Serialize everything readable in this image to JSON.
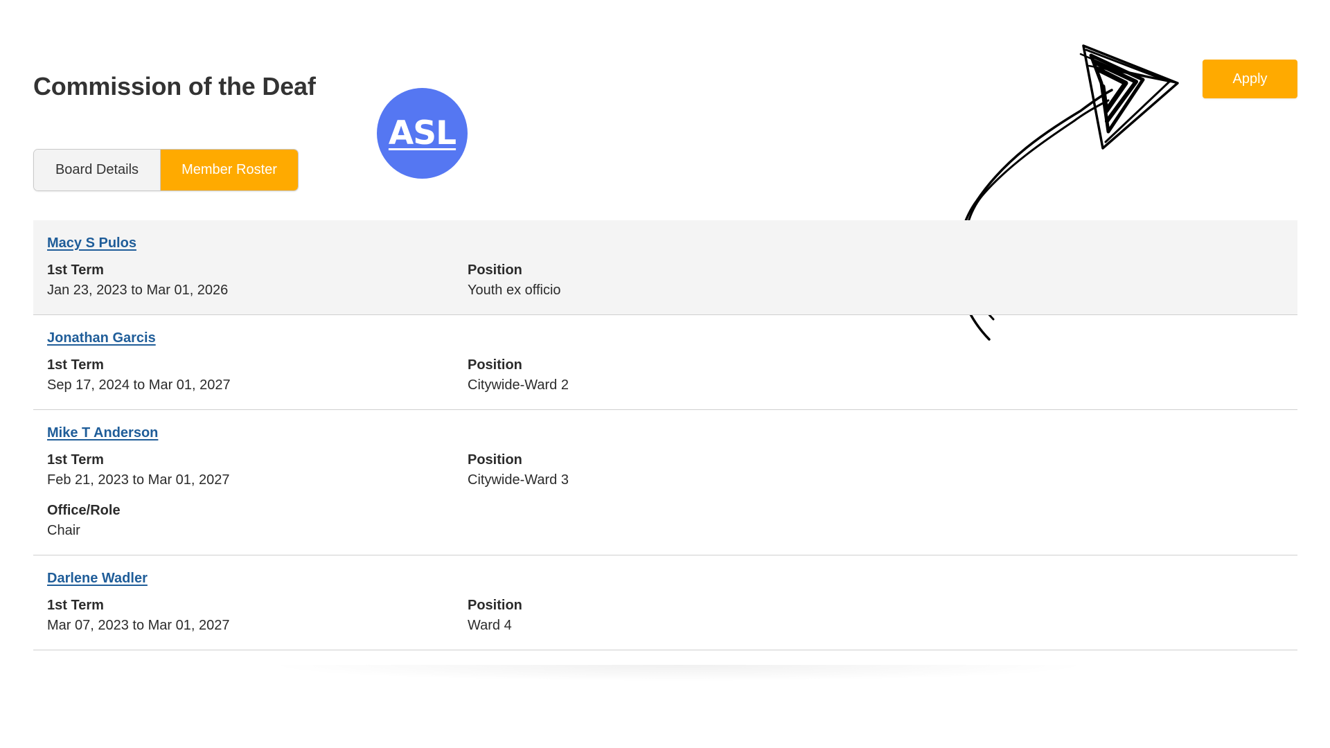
{
  "page": {
    "title": "Commission of the Deaf"
  },
  "asl_badge": {
    "label": "ASL",
    "color": "#5577f2"
  },
  "tabs": [
    {
      "label": "Board Details",
      "active": false
    },
    {
      "label": "Member Roster",
      "active": true
    }
  ],
  "apply_button": {
    "label": "Apply",
    "color": "#ffaa00"
  },
  "colors": {
    "accent": "#ffaa00",
    "link": "#1f5d99"
  },
  "members": [
    {
      "name": "Macy S Pulos",
      "term_label": "1st Term",
      "term_value": "Jan 23, 2023 to Mar 01, 2026",
      "position_label": "Position",
      "position_value": "Youth ex officio"
    },
    {
      "name": "Jonathan Garcis",
      "term_label": "1st Term",
      "term_value": "Sep 17, 2024 to Mar 01, 2027",
      "position_label": "Position",
      "position_value": "Citywide-Ward 2"
    },
    {
      "name": "Mike T Anderson",
      "term_label": "1st Term",
      "term_value": "Feb 21, 2023 to Mar 01, 2027",
      "position_label": "Position",
      "position_value": "Citywide-Ward 3",
      "office_label": "Office/Role",
      "office_value": "Chair"
    },
    {
      "name": "Darlene Wadler",
      "term_label": "1st Term",
      "term_value": "Mar 07, 2023 to Mar 01, 2027",
      "position_label": "Position",
      "position_value": "Ward 4"
    }
  ]
}
